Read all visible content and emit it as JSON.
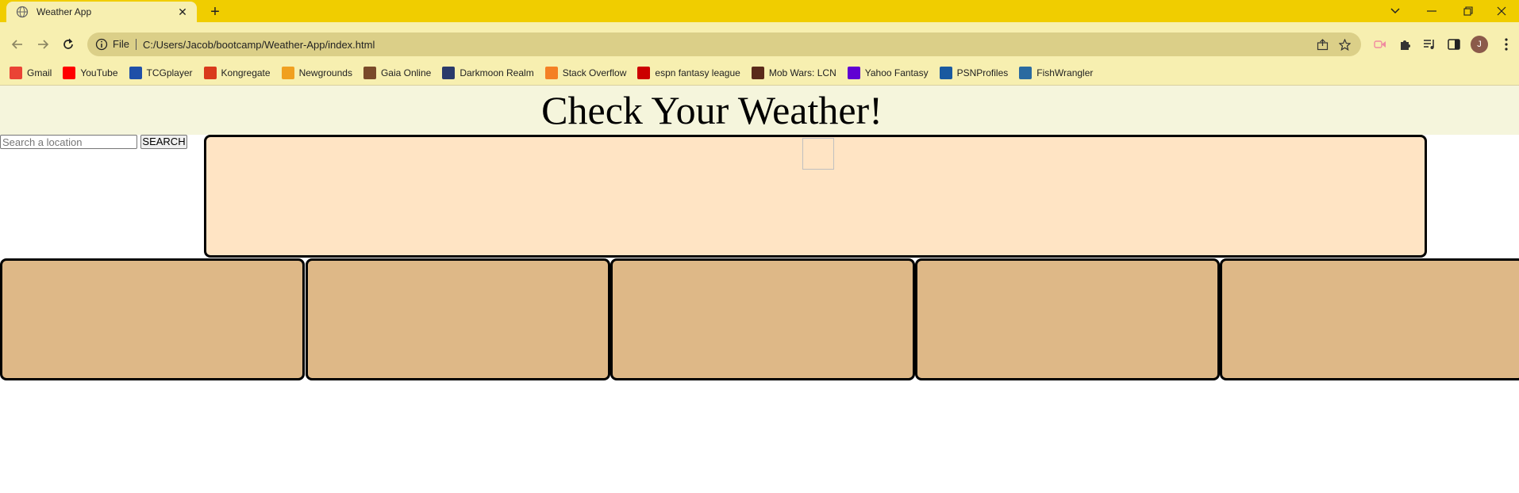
{
  "browser": {
    "tab_title": "Weather App",
    "tab_close": "✕",
    "new_tab": "+",
    "protocol_label": "File",
    "url": "C:/Users/Jacob/bootcamp/Weather-App/index.html",
    "profile_initial": "J",
    "bookmarks": [
      {
        "label": "Gmail",
        "color": "#ea4335"
      },
      {
        "label": "YouTube",
        "color": "#ff0000"
      },
      {
        "label": "TCGplayer",
        "color": "#1f4fa8"
      },
      {
        "label": "Kongregate",
        "color": "#d93a1c"
      },
      {
        "label": "Newgrounds",
        "color": "#f0a020"
      },
      {
        "label": "Gaia Online",
        "color": "#7a4a2a"
      },
      {
        "label": "Darkmoon Realm",
        "color": "#2a3a6a"
      },
      {
        "label": "Stack Overflow",
        "color": "#f48024"
      },
      {
        "label": "espn fantasy league",
        "color": "#cc0000"
      },
      {
        "label": "Mob Wars: LCN",
        "color": "#5a2a1a"
      },
      {
        "label": "Yahoo Fantasy",
        "color": "#6001d2"
      },
      {
        "label": "PSNProfiles",
        "color": "#1a5aa0"
      },
      {
        "label": "FishWrangler",
        "color": "#2a6aa0"
      }
    ]
  },
  "page": {
    "title": "Check Your Weather!",
    "search_placeholder": "Search a location",
    "search_button": "SEARCH"
  },
  "colors": {
    "header_bg": "#f5f5dc",
    "current_card_bg": "#ffe4c4",
    "forecast_card_bg": "#deb887"
  },
  "forecast_cards": 5
}
